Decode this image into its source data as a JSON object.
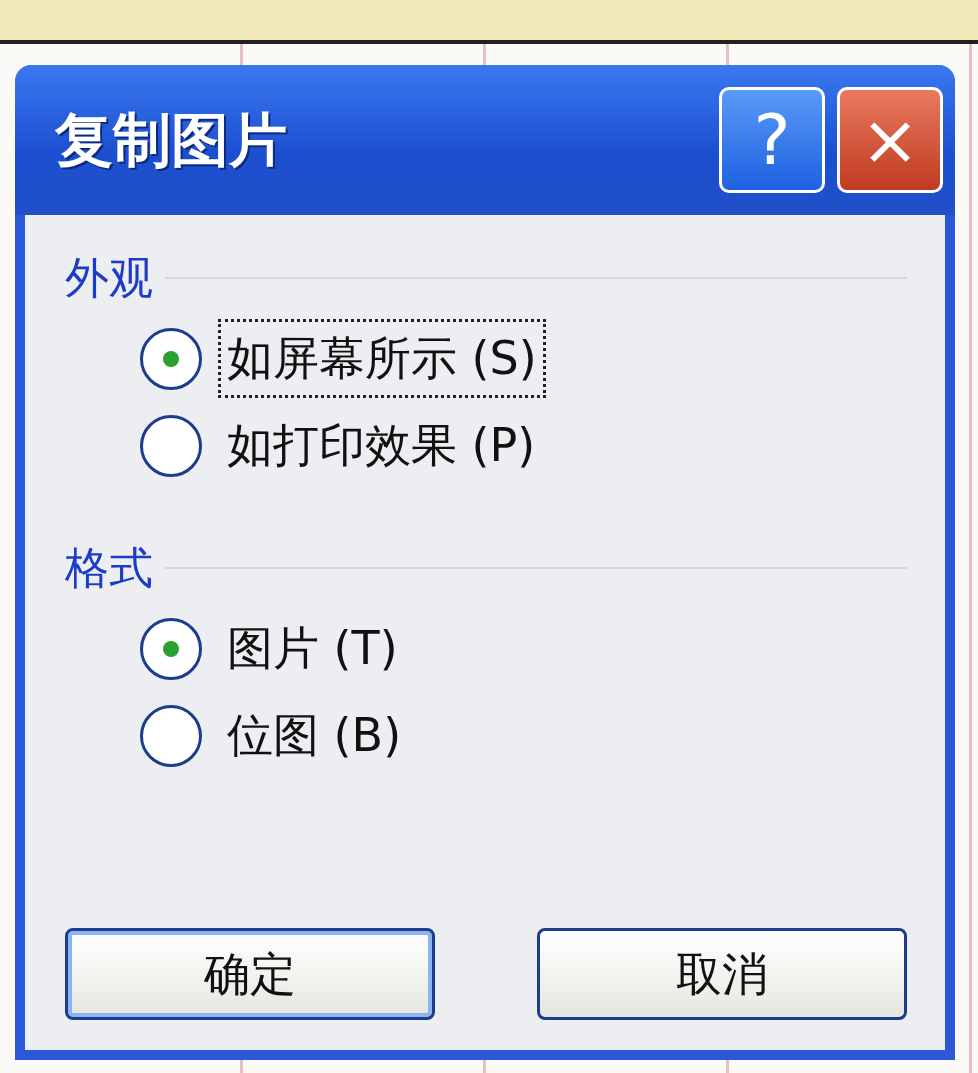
{
  "window": {
    "title": "复制图片",
    "help_button": "?",
    "close_button": "×"
  },
  "groups": [
    {
      "label": "外观",
      "options": [
        {
          "label": "如屏幕所示 (S)",
          "selected": true,
          "focused": true
        },
        {
          "label": "如打印效果 (P)",
          "selected": false,
          "focused": false
        }
      ]
    },
    {
      "label": "格式",
      "options": [
        {
          "label": "图片 (T)",
          "selected": true,
          "focused": false
        },
        {
          "label": "位图 (B)",
          "selected": false,
          "focused": false
        }
      ]
    }
  ],
  "buttons": [
    {
      "label": "确定",
      "default": true
    },
    {
      "label": "取消",
      "default": false
    }
  ]
}
